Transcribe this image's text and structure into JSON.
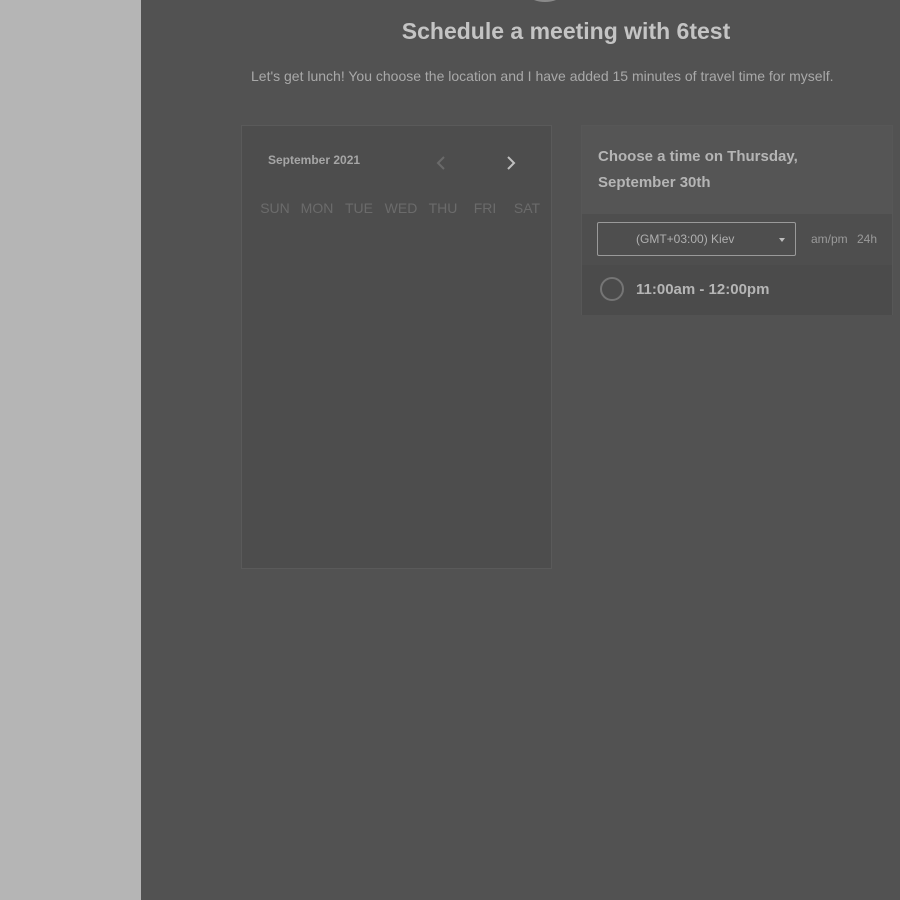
{
  "page": {
    "title": "Schedule a meeting with 6test",
    "description": "Let's get lunch! You choose the location and I have added 15 minutes of travel time for myself."
  },
  "calendar": {
    "month_label": "September 2021",
    "prev_icon": "chevron-left-icon",
    "next_icon": "chevron-right-icon",
    "weekdays": [
      "SUN",
      "MON",
      "TUE",
      "WED",
      "THU",
      "FRI",
      "SAT"
    ]
  },
  "times": {
    "heading": "Choose a time on Thursday, September 30th",
    "timezone": "(GMT+03:00) Kiev",
    "format_ampm": "am/pm",
    "format_24h": "24h",
    "slots": [
      "11:00am - 12:00pm"
    ]
  },
  "colors": {
    "overlay": "#525252",
    "sidebar": "#b5b5b5",
    "text": "#c4c4c4"
  }
}
